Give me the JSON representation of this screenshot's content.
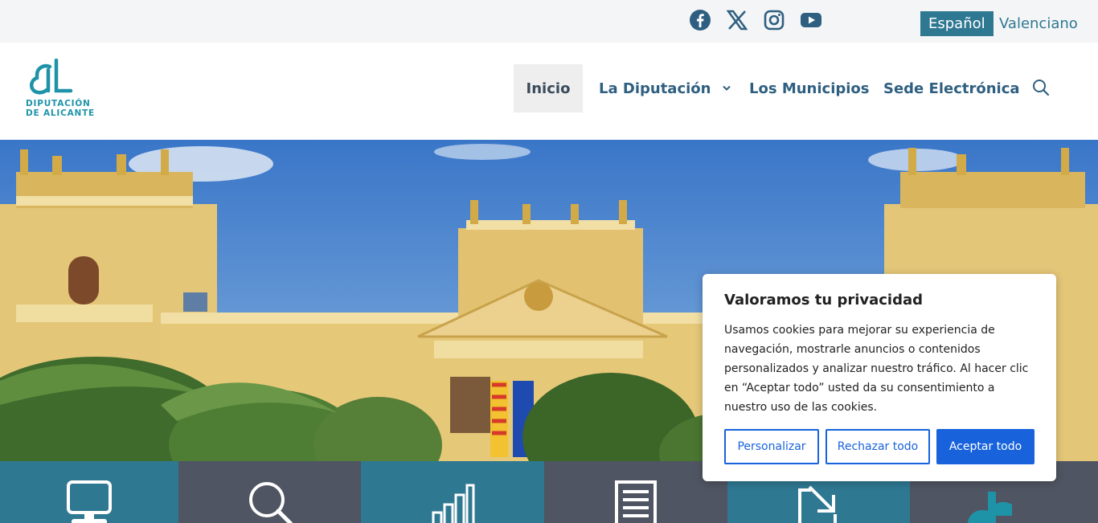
{
  "topbar": {
    "social": [
      {
        "icon": "facebook-icon"
      },
      {
        "icon": "x-twitter-icon"
      },
      {
        "icon": "instagram-icon"
      },
      {
        "icon": "youtube-icon"
      }
    ],
    "languages": [
      {
        "label": "Español",
        "active": true
      },
      {
        "label": "Valenciano",
        "active": false
      }
    ]
  },
  "header": {
    "logo_text_line1": "DIPUTACIÓN",
    "logo_text_line2": "DE ALICANTE",
    "nav": [
      {
        "label": "Inicio",
        "active": true
      },
      {
        "label": "La Diputación",
        "has_dropdown": true
      },
      {
        "label": "Los Municipios"
      },
      {
        "label": "Sede Electrónica"
      }
    ],
    "search_icon": "search-icon"
  },
  "hero": {
    "image": "diputacion-palace-facade"
  },
  "tiles": [
    {
      "icon": "computer-icon",
      "color": "#2f7892"
    },
    {
      "icon": "magnifier-icon",
      "color": "#4f5562"
    },
    {
      "icon": "bar-chart-icon",
      "color": "#2f7892"
    },
    {
      "icon": "document-icon",
      "color": "#4f5562"
    },
    {
      "icon": "arrow-down-right-icon",
      "color": "#2f7892"
    },
    {
      "icon": "logo-icon",
      "color": "#4f5562"
    }
  ],
  "cookie": {
    "title": "Valoramos tu privacidad",
    "body": "Usamos cookies para mejorar su experiencia de navegación, mostrarle anuncios o contenidos personalizados y analizar nuestro tráfico. Al hacer clic en “Aceptar todo” usted da su consentimiento a nuestro uso de las cookies.",
    "customize_label": "Personalizar",
    "reject_label": "Rechazar todo",
    "accept_label": "Aceptar todo"
  },
  "colors": {
    "brand": "#2f7892",
    "accent": "#1863dc",
    "tile_dark": "#4f5562"
  }
}
